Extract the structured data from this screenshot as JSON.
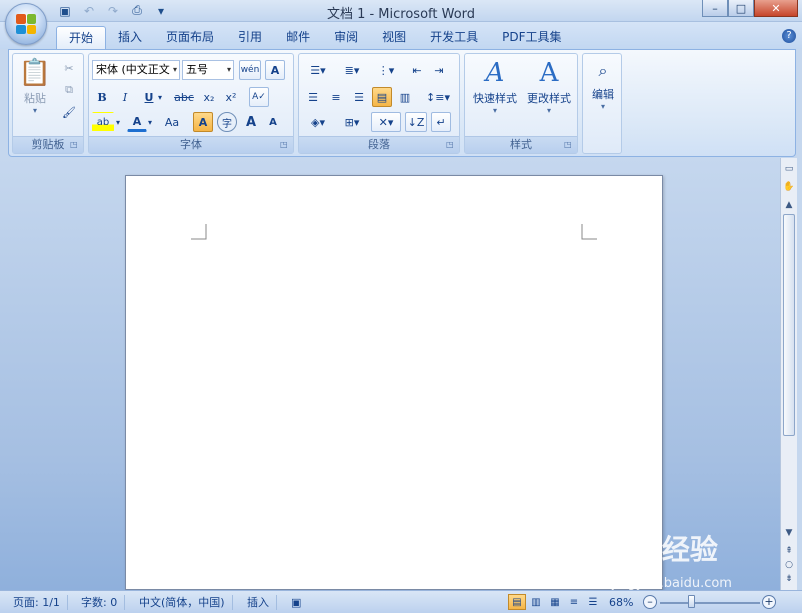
{
  "window": {
    "title": "文档 1 - Microsoft Word",
    "controls": {
      "minimize": "–",
      "maximize": "□",
      "close": "✕"
    }
  },
  "quick_access": [
    "save-icon",
    "undo-icon",
    "redo-icon",
    "print-preview-icon",
    "customize-icon"
  ],
  "tabs": [
    {
      "label": "开始",
      "active": true
    },
    {
      "label": "插入"
    },
    {
      "label": "页面布局"
    },
    {
      "label": "引用"
    },
    {
      "label": "邮件"
    },
    {
      "label": "审阅"
    },
    {
      "label": "视图"
    },
    {
      "label": "开发工具"
    },
    {
      "label": "PDF工具集"
    }
  ],
  "ribbon": {
    "clipboard": {
      "label": "剪贴板",
      "paste_label": "粘贴"
    },
    "font": {
      "label": "字体",
      "font_name": "宋体 (中文正文",
      "font_size": "五号",
      "phonetic": "wén",
      "bold": "B",
      "italic": "I",
      "underline": "U",
      "strike": "abc",
      "subscript": "x₂",
      "superscript": "x²",
      "grow": "A",
      "shrink": "A",
      "case": "Aa",
      "shading": "A",
      "enclose": "字"
    },
    "paragraph": {
      "label": "段落"
    },
    "styles": {
      "label": "样式",
      "quick_styles": "快速样式",
      "change_styles": "更改样式"
    },
    "editing": {
      "label": "编辑"
    }
  },
  "statusbar": {
    "page": "页面: 1/1",
    "words": "字数: 0",
    "language": "中文(简体，中国)",
    "mode": "插入",
    "zoom": "68%",
    "zoom_minus": "–",
    "zoom_plus": "+"
  },
  "watermark": {
    "brand": "Bai经验",
    "url": "jingyan.baidu.com"
  },
  "colors": {
    "accent": "#15428b",
    "ribbon_border": "#8db2e3",
    "active_button": "#f5b547"
  }
}
